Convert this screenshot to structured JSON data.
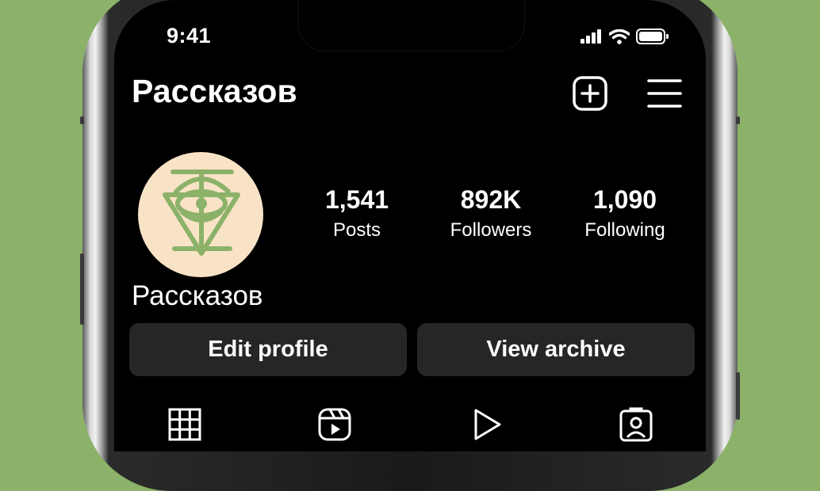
{
  "status_bar": {
    "time": "9:41",
    "icons": [
      "cellular-signal-icon",
      "wifi-icon",
      "battery-icon"
    ]
  },
  "header": {
    "username": "Рассказов",
    "actions": [
      "new-post-icon",
      "menu-icon"
    ]
  },
  "profile": {
    "display_name": "Рассказов",
    "avatar_colors": {
      "background": "#f9e3c6",
      "emblem": "#8cb26a"
    },
    "stats": [
      {
        "value": "1,541",
        "label": "Posts"
      },
      {
        "value": "892K",
        "label": "Followers"
      },
      {
        "value": "1,090",
        "label": "Following"
      }
    ]
  },
  "buttons": {
    "edit_profile": "Edit profile",
    "view_archive": "View archive"
  },
  "tabs": [
    "grid-icon",
    "reels-icon",
    "video-icon",
    "tagged-icon"
  ],
  "colors": {
    "page_background": "#8cb26a",
    "screen": "#000000",
    "button": "#262626"
  }
}
